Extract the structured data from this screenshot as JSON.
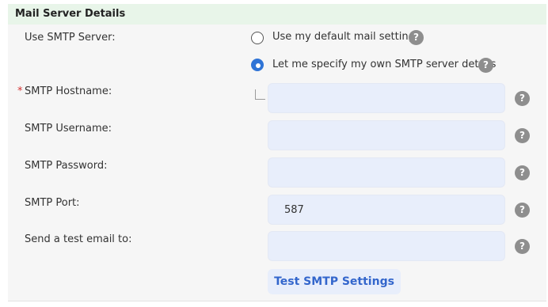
{
  "panel": {
    "title": "Mail Server Details"
  },
  "smtp_server": {
    "label": "Use SMTP Server:",
    "options": [
      {
        "label": "Use my default mail settings",
        "selected": false
      },
      {
        "label": "Let me specify my own SMTP server details",
        "selected": true
      }
    ]
  },
  "fields": {
    "hostname": {
      "label": "SMTP Hostname:",
      "required_mark": "*",
      "value": ""
    },
    "username": {
      "label": "SMTP Username:",
      "value": ""
    },
    "password": {
      "label": "SMTP Password:",
      "value": ""
    },
    "port": {
      "label": "SMTP Port:",
      "value": "587"
    },
    "test_email": {
      "label": "Send a test email to:",
      "value": ""
    }
  },
  "help_glyph": "?",
  "test_button": {
    "label": "Test SMTP Settings"
  },
  "colors": {
    "header_bg": "#e8f5e9",
    "accent": "#2f74d6",
    "field_bg": "#e8eefb",
    "button_text": "#3366cc",
    "required": "#d32f2f"
  }
}
